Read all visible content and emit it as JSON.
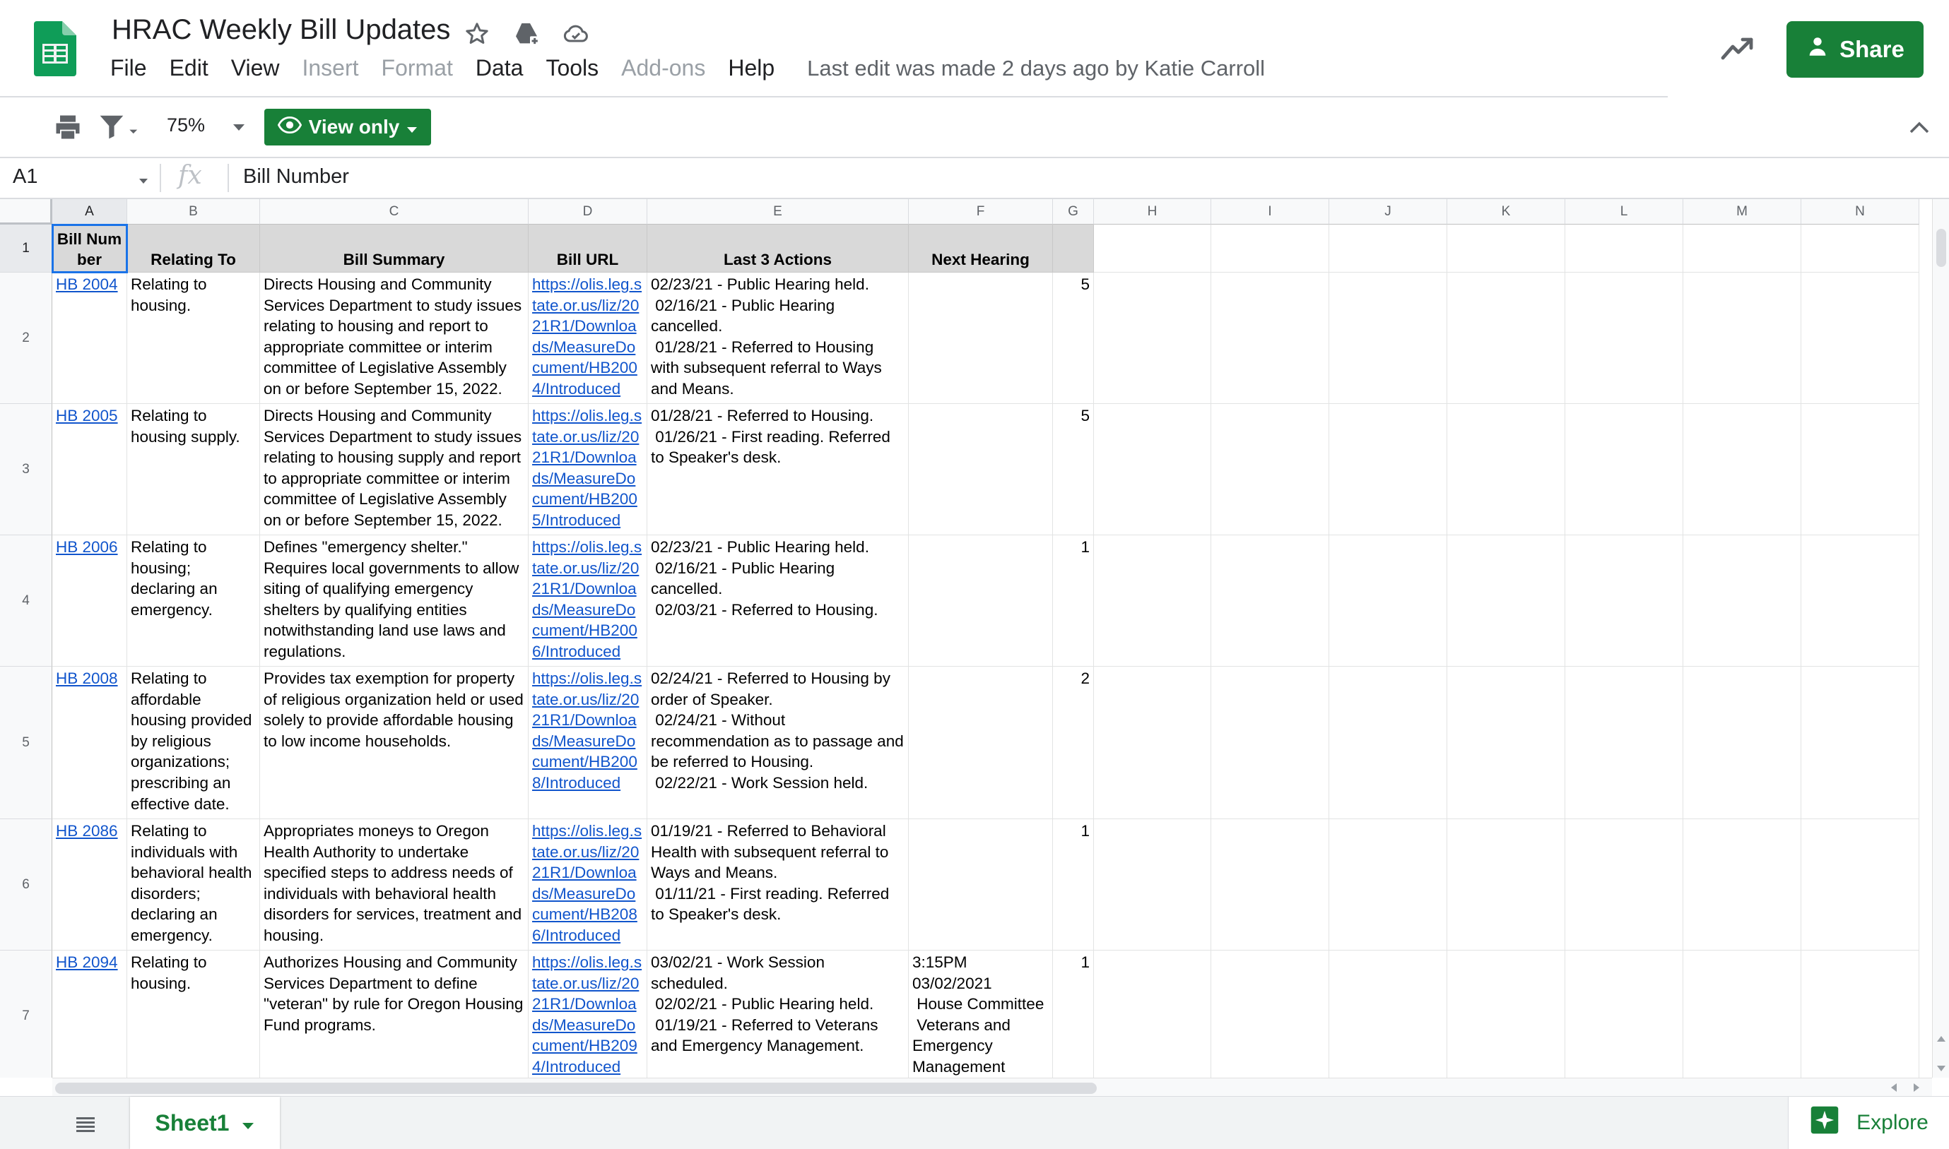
{
  "app": {
    "doc_title": "HRAC Weekly Bill Updates",
    "menus": [
      {
        "label": "File",
        "enabled": true
      },
      {
        "label": "Edit",
        "enabled": true
      },
      {
        "label": "View",
        "enabled": true
      },
      {
        "label": "Insert",
        "enabled": false
      },
      {
        "label": "Format",
        "enabled": false
      },
      {
        "label": "Data",
        "enabled": true
      },
      {
        "label": "Tools",
        "enabled": true
      },
      {
        "label": "Add-ons",
        "enabled": false
      },
      {
        "label": "Help",
        "enabled": true
      }
    ],
    "last_edit": "Last edit was made 2 days ago by Katie Carroll",
    "share_label": "Share",
    "colors": {
      "brand_green": "#188038",
      "link_blue": "#1155cc",
      "selection_blue": "#1a73e8",
      "header_fill": "#d9d9d9"
    }
  },
  "toolbar": {
    "zoom": "75%",
    "view_only_label": "View only"
  },
  "formula_bar": {
    "cell_ref": "A1",
    "fx_label": "fx",
    "value": "Bill Number"
  },
  "grid": {
    "selected_cell": "A1",
    "columns": [
      "A",
      "B",
      "C",
      "D",
      "E",
      "F",
      "G",
      "H",
      "I",
      "J",
      "K",
      "L",
      "M",
      "N"
    ],
    "row_numbers": [
      "1",
      "2",
      "3",
      "4",
      "5",
      "6",
      "7"
    ],
    "header_row": [
      "Bill Number",
      "Relating To",
      "Bill Summary",
      "Bill URL",
      "Last 3 Actions",
      "Next Hearing",
      ""
    ],
    "rows": [
      {
        "bill": "HB 2004",
        "relating": "Relating to housing.",
        "summary": "Directs Housing and Community Services Department to study issues relating to housing and report to appropriate committee or interim committee of Legislative Assembly on or before September 15, 2022.",
        "url": "https://olis.leg.state.or.us/liz/2021R1/Downloads/MeasureDocument/HB2004/Introduced",
        "actions": "02/23/21 - Public Hearing held.\n 02/16/21 - Public Hearing cancelled.\n 01/28/21 - Referred to Housing with subsequent referral to Ways and Means.",
        "hearing": "",
        "count": "5"
      },
      {
        "bill": "HB 2005",
        "relating": "Relating to housing supply.",
        "summary": "Directs Housing and Community Services Department to study issues relating to housing supply and report to appropriate committee or interim committee of Legislative Assembly on or before September 15, 2022.",
        "url": "https://olis.leg.state.or.us/liz/2021R1/Downloads/MeasureDocument/HB2005/Introduced",
        "actions": "01/28/21 - Referred to Housing.\n 01/26/21 - First reading. Referred to Speaker's desk.",
        "hearing": "",
        "count": "5"
      },
      {
        "bill": "HB 2006",
        "relating": "Relating to housing; declaring an emergency.",
        "summary": "Defines \"emergency shelter.\" Requires local governments to allow siting of qualifying emergency shelters by qualifying entities notwithstanding land use laws and regulations.",
        "url": "https://olis.leg.state.or.us/liz/2021R1/Downloads/MeasureDocument/HB2006/Introduced",
        "actions": "02/23/21 - Public Hearing held.\n 02/16/21 - Public Hearing cancelled.\n 02/03/21 - Referred to Housing.",
        "hearing": "",
        "count": "1"
      },
      {
        "bill": "HB 2008",
        "relating": "Relating to affordable housing provided by religious organizations; prescribing an effective date.",
        "summary": "Provides tax exemption for property of religious organization held or used solely to provide affordable housing to low income households.",
        "url": "https://olis.leg.state.or.us/liz/2021R1/Downloads/MeasureDocument/HB2008/Introduced",
        "actions": "02/24/21 - Referred to Housing by order of Speaker.\n 02/24/21 - Without recommendation as to passage and be referred to Housing.\n 02/22/21 - Work Session held.",
        "hearing": "",
        "count": "2"
      },
      {
        "bill": "HB 2086",
        "relating": "Relating to individuals with behavioral health disorders; declaring an emergency.",
        "summary": "Appropriates moneys to Oregon Health Authority to undertake specified steps to address needs of individuals with behavioral health disorders for services, treatment and housing.",
        "url": "https://olis.leg.state.or.us/liz/2021R1/Downloads/MeasureDocument/HB2086/Introduced",
        "actions": "01/19/21 - Referred to Behavioral Health with subsequent referral to Ways and Means.\n 01/11/21 - First reading. Referred to Speaker's desk.",
        "hearing": "",
        "count": "1"
      },
      {
        "bill": "HB 2094",
        "relating": "Relating to housing.",
        "summary": "Authorizes Housing and Community Services Department to define \"veteran\" by rule for Oregon Housing Fund programs.",
        "url": "https://olis.leg.state.or.us/liz/2021R1/Downloads/MeasureDocument/HB2094/Introduced",
        "actions": "03/02/21 - Work Session scheduled.\n 02/02/21 - Public Hearing held.\n 01/19/21 - Referred to Veterans and Emergency Management.",
        "hearing": "3:15PM\n03/02/2021\n House Committee\n Veterans and Emergency Management",
        "count": "1"
      }
    ]
  },
  "footer": {
    "sheet_tab": "Sheet1",
    "explore_label": "Explore"
  }
}
